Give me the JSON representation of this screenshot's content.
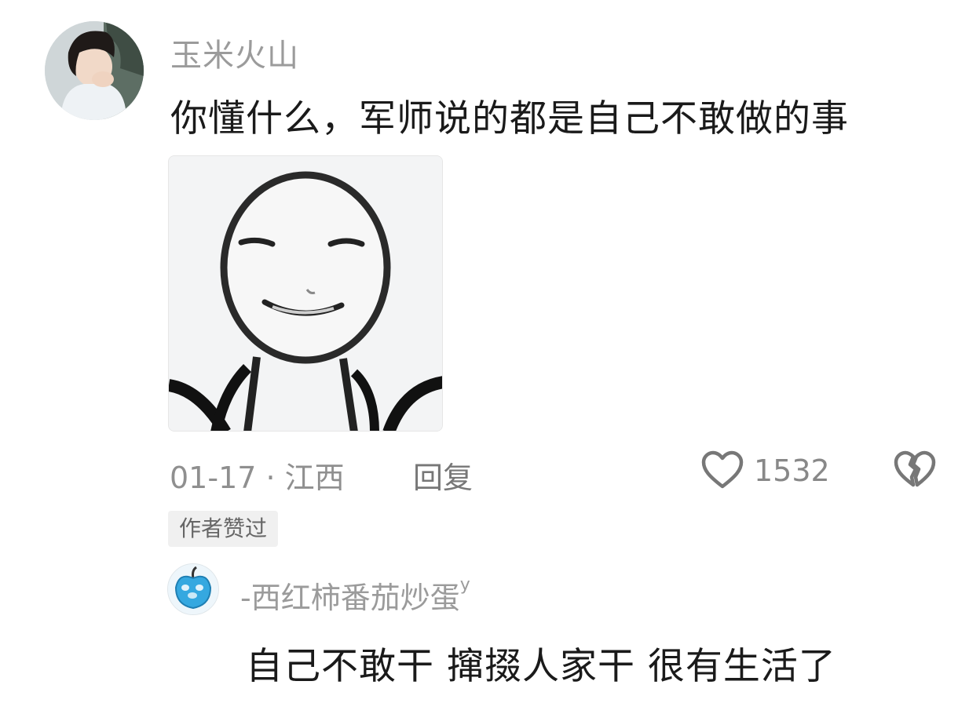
{
  "comment": {
    "username": "玉米火山",
    "text": "你懂什么，军师说的都是自己不敢做的事",
    "avatar": "user-avatar-photo",
    "sticker": "smiling-stickman-sticker",
    "meta": "01-17 · 江西",
    "reply_label": "回复",
    "like_count": "1532",
    "like_icon": "heart-outline-icon",
    "dislike_icon": "broken-heart-icon",
    "author_badge": "作者赞过"
  },
  "sub_comment": {
    "username": "-西红柿番茄炒蛋",
    "username_suffix": "y",
    "avatar": "blue-apple-avatar",
    "text": "自己不敢干 撺掇人家干 很有生活了"
  }
}
